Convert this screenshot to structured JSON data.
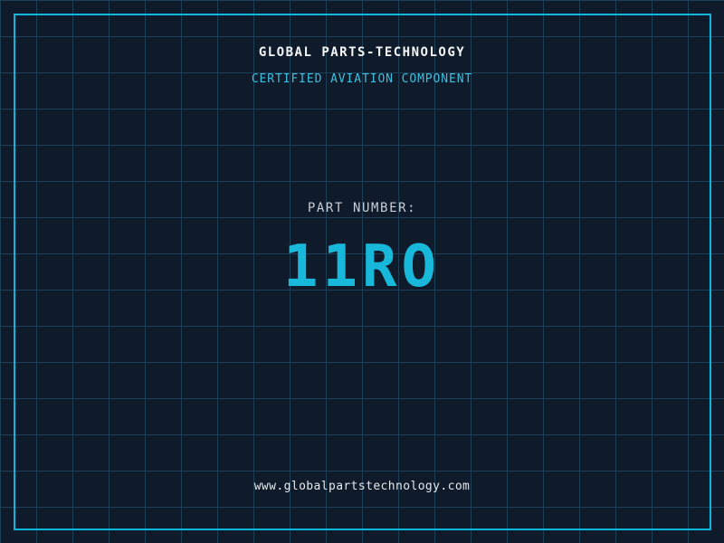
{
  "company": {
    "name": "GLOBAL PARTS-TECHNOLOGY",
    "tagline": "CERTIFIED AVIATION COMPONENT",
    "website": "www.globalpartstechnology.com"
  },
  "part": {
    "label": "PART NUMBER:",
    "number": "11RO"
  },
  "colors": {
    "background": "#0f1a2a",
    "grid_line": "#1d3f55",
    "frame_border": "#0cb6dc",
    "part_number_text": "#18b8da",
    "tagline_text": "#3cc0e0",
    "heading_text": "#f4f6f8",
    "label_text": "#c9ced8",
    "website_text": "#e6e9ed"
  }
}
